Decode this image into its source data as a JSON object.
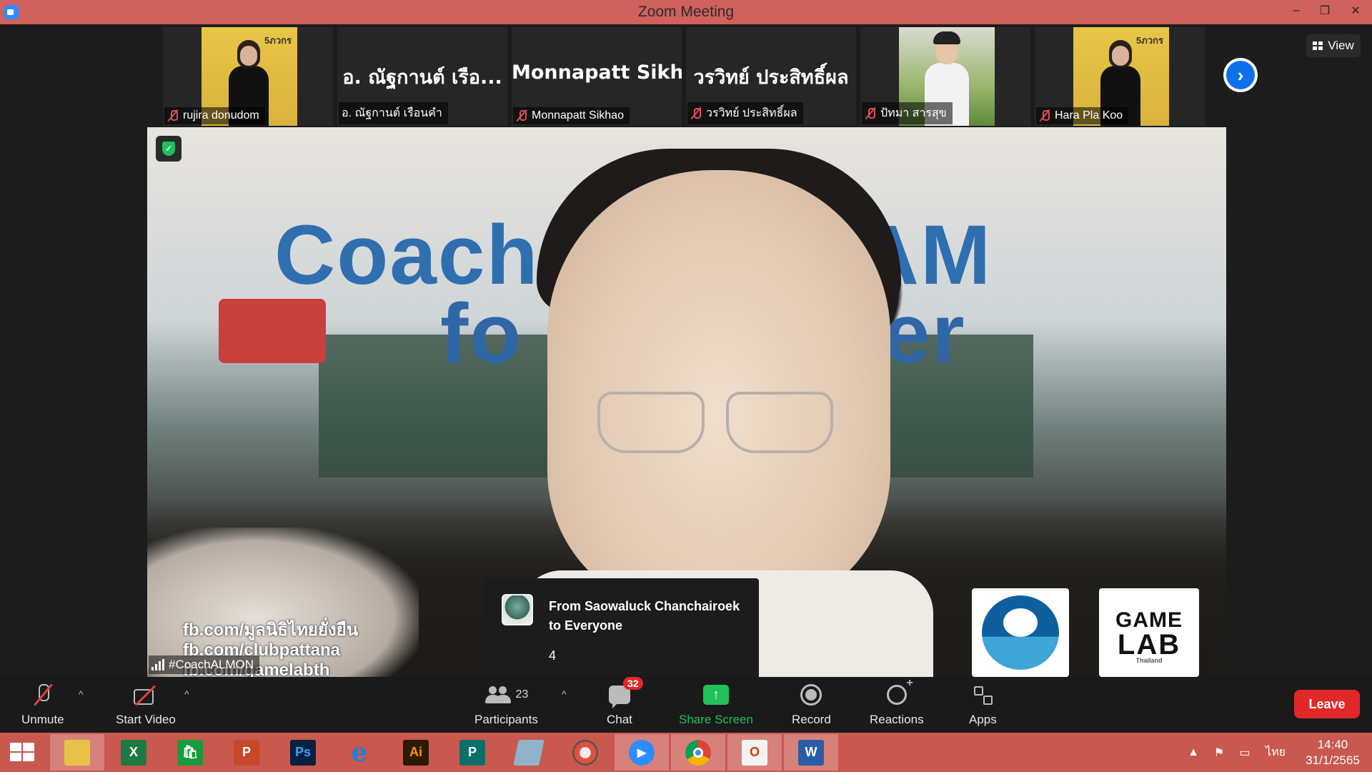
{
  "window": {
    "title": "Zoom Meeting",
    "minimize_glyph": "–",
    "restore_glyph": "❐",
    "close_glyph": "✕"
  },
  "gallery": {
    "tiles": [
      {
        "name": "rujira donudom",
        "type": "photo-yellow",
        "badge": "5ภวกร"
      },
      {
        "name": "อ. ณัฐกานต์  เรือนคำ",
        "big_name": "อ. ณัฐกานต์  เรือ...",
        "type": "text"
      },
      {
        "name": "Monnapatt Sikhao",
        "big_name": "Monnapatt  Sikh...",
        "type": "text"
      },
      {
        "name": "วรวิทย์ ประสิทธิ์ผล",
        "big_name": "วรวิทย์ ประสิทธิ์ผล",
        "type": "text"
      },
      {
        "name": "ปัทมา สารสุข",
        "type": "photo-green"
      },
      {
        "name": "Hara Pla Koo",
        "type": "photo-yellow",
        "badge": "5ภวกร"
      }
    ],
    "next_glyph": "›",
    "view_label": "View"
  },
  "main_video": {
    "banner_top_left": "Coach",
    "banner_top_right": "OGRAM",
    "banner_bottom_left": "fo",
    "banner_bottom_right": "er",
    "overlay_lines": [
      "fb.com/มูลนิธิไทยยั่งยืน",
      "fb.com/clubpattana",
      "fb.com/gamelabth"
    ],
    "game_logo": {
      "line1": "GAME",
      "line2": "LAB",
      "line3": "Thailand"
    },
    "speaker_name": "#CoachALMON",
    "security_glyph": "✓"
  },
  "chat_popup": {
    "from": "From Saowaluck Chanchairoek to Everyone",
    "message": "4"
  },
  "toolbar": {
    "unmute_label": "Unmute",
    "start_video_label": "Start Video",
    "participants_label": "Participants",
    "participants_count": "23",
    "chat_label": "Chat",
    "chat_badge": "32",
    "share_label": "Share Screen",
    "share_glyph": "↑",
    "record_label": "Record",
    "reactions_label": "Reactions",
    "apps_label": "Apps",
    "leave_label": "Leave",
    "caret_glyph": "^"
  },
  "taskbar": {
    "apps": [
      {
        "name": "file-explorer",
        "glyph": "",
        "color": "#e8c34a"
      },
      {
        "name": "excel",
        "glyph": "X",
        "color": "#1d7a45"
      },
      {
        "name": "store",
        "glyph": "🛍",
        "color": "#1a9a3c"
      },
      {
        "name": "powerpoint",
        "glyph": "P",
        "color": "#c8472a"
      },
      {
        "name": "photoshop",
        "glyph": "Ps",
        "color": "#0b1f3f"
      },
      {
        "name": "internet-explorer",
        "glyph": "e",
        "color": "#1f7fd8"
      },
      {
        "name": "illustrator",
        "glyph": "Ai",
        "color": "#2d1a04"
      },
      {
        "name": "publisher",
        "glyph": "P",
        "color": "#0e6f6a"
      },
      {
        "name": "notes",
        "glyph": "",
        "color": "#8fb4c9"
      },
      {
        "name": "photoscape",
        "glyph": "",
        "color": "#555555"
      },
      {
        "name": "zoom",
        "glyph": "▶",
        "color": "#2d8cff"
      },
      {
        "name": "chrome",
        "glyph": "",
        "color": "#db4437"
      },
      {
        "name": "office",
        "glyph": "O",
        "color": "#f3f3f3"
      },
      {
        "name": "word",
        "glyph": "W",
        "color": "#2a5ca8"
      }
    ],
    "tray_up_glyph": "▲",
    "language": "ไทย",
    "time": "14:40",
    "date": "31/1/2565"
  }
}
